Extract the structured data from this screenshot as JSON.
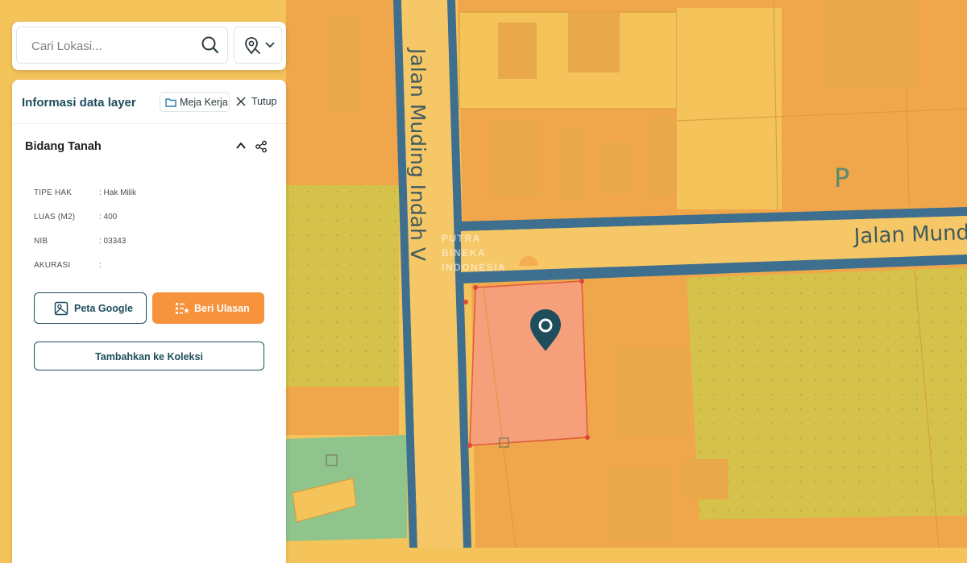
{
  "search": {
    "placeholder": "Cari Lokasi..."
  },
  "icons": {
    "search": "search-icon",
    "location": "map-pin-search-icon",
    "chevron": "chevron-down-icon",
    "folder": "folder-icon",
    "close": "close-icon",
    "collapse": "chevron-up-icon",
    "share": "share-icon",
    "map": "map-image-icon",
    "review": "list-star-icon",
    "marker": "location-marker-icon"
  },
  "panel": {
    "title": "Informasi data layer",
    "workspace_label": "Meja Kerja",
    "close_label": "Tutup",
    "section_title": "Bidang Tanah",
    "attributes": [
      {
        "key": "TIPE HAK",
        "value": ": Hak Milik"
      },
      {
        "key": "LUAS (M2)",
        "value": ": 400"
      },
      {
        "key": "NIB",
        "value": ": 03343"
      },
      {
        "key": "AKURASI",
        "value": ":"
      }
    ],
    "buttons": {
      "google_map": "Peta Google",
      "review": "Beri Ulasan",
      "add_collection": "Tambahkan ke Koleksi"
    }
  },
  "map": {
    "street_vertical": "Jalan Muding Indah V",
    "street_horizontal": "Jalan Mund",
    "zone_letter": "P",
    "watermark": [
      "PUTRA",
      "BINEKA",
      "INDONESIA"
    ]
  },
  "colors": {
    "accent_orange": "#f7923d",
    "primary_teal": "#1e4d5c",
    "road_blue": "#3f6f8e",
    "parcel_yellow": "#f4c35a",
    "parcel_orange": "#f0a64a",
    "parcel_olive": "#d4c24a",
    "parcel_green": "#8fc58c",
    "selected_parcel": "#f5a07a"
  }
}
